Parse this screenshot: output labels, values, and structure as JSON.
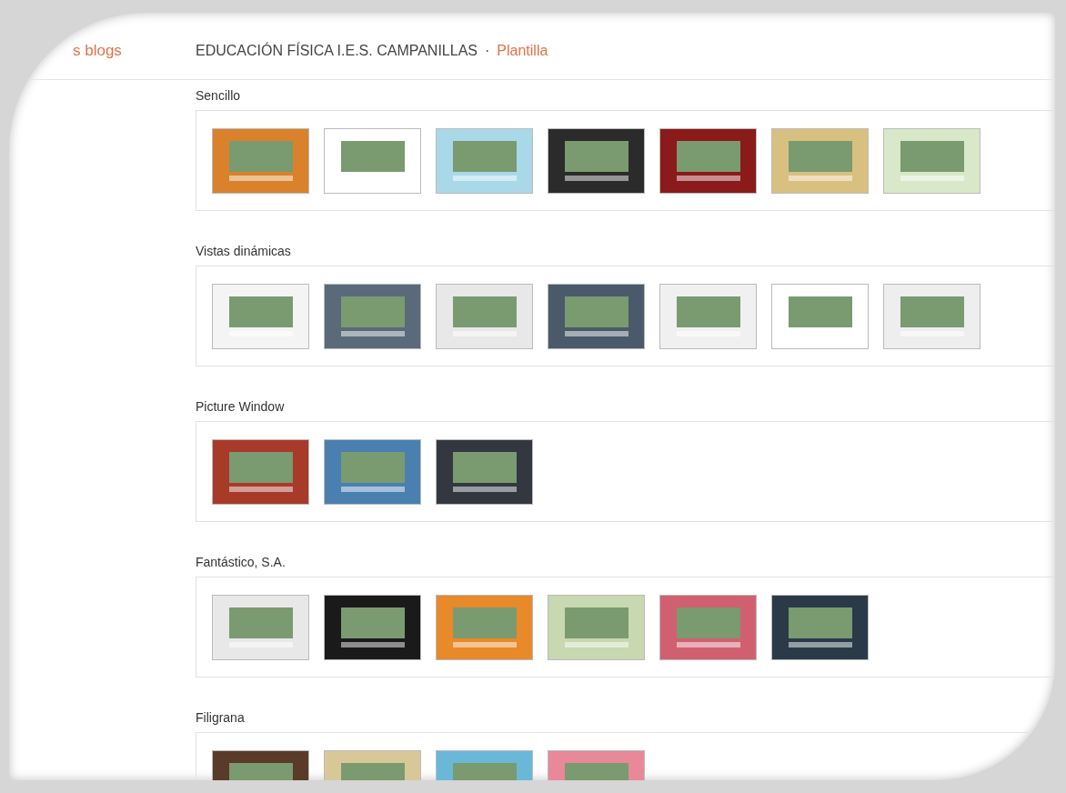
{
  "nav": {
    "back_link": "s blogs",
    "blog_title": "EDUCACIÓN FÍSICA I.E.S. CAMPANILLAS",
    "separator": "·",
    "page": "Plantilla"
  },
  "sections": [
    {
      "title": "Sencillo",
      "thumbnails": [
        {
          "color": "#d9822b"
        },
        {
          "color": "#ffffff"
        },
        {
          "color": "#a9d8e8"
        },
        {
          "color": "#2b2b2b"
        },
        {
          "color": "#8b1a1a"
        },
        {
          "color": "#d8c080"
        },
        {
          "color": "#d8e8c8"
        }
      ]
    },
    {
      "title": "Vistas dinámicas",
      "thumbnails": [
        {
          "color": "#f4f4f4"
        },
        {
          "color": "#5a6a7a"
        },
        {
          "color": "#e8e8e8"
        },
        {
          "color": "#4a5a6a"
        },
        {
          "color": "#f0f0f0"
        },
        {
          "color": "#ffffff"
        },
        {
          "color": "#eeeeee"
        }
      ]
    },
    {
      "title": "Picture Window",
      "thumbnails": [
        {
          "color": "#a83a2a"
        },
        {
          "color": "#4a80b0"
        },
        {
          "color": "#333840"
        }
      ]
    },
    {
      "title": "Fantástico, S.A.",
      "thumbnails": [
        {
          "color": "#e8e8e8"
        },
        {
          "color": "#1a1a1a"
        },
        {
          "color": "#e8892a"
        },
        {
          "color": "#c8d8b0"
        },
        {
          "color": "#d06070"
        },
        {
          "color": "#2a3a48"
        }
      ]
    },
    {
      "title": "Filigrana",
      "thumbnails": [
        {
          "color": "#5a3a28"
        },
        {
          "color": "#d8c898"
        },
        {
          "color": "#6ab8d8"
        },
        {
          "color": "#e88898"
        }
      ]
    }
  ]
}
